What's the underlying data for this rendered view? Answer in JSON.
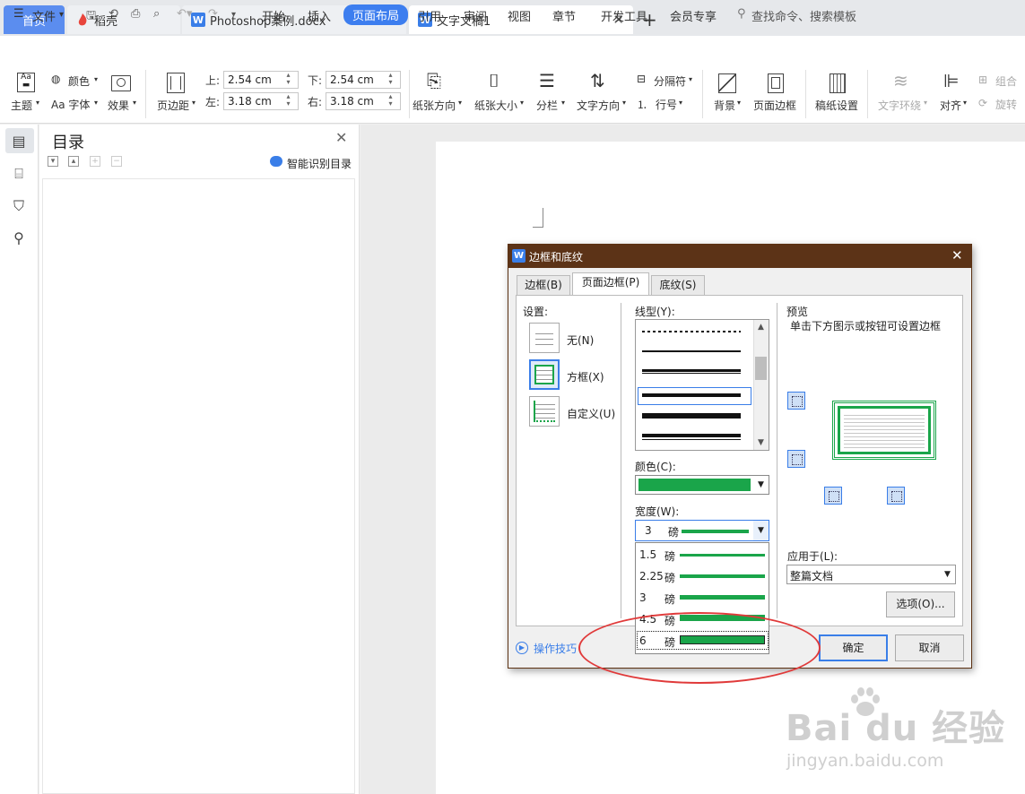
{
  "tabs": {
    "home": "首页",
    "daoke": "稻壳",
    "doc1": "Photoshop案例.docx",
    "doc2": "文字文稿1"
  },
  "menu": {
    "file": "文件",
    "items": [
      "开始",
      "插入",
      "页面布局",
      "引用",
      "审阅",
      "视图",
      "章节",
      "开发工具",
      "会员专享"
    ],
    "search": "查找命令、搜索模板"
  },
  "ribbon": {
    "theme": "主题",
    "color": "颜色",
    "font": "Aa 字体",
    "effect": "效果",
    "margins": "页边距",
    "top_label": "上:",
    "top_value": "2.54 cm",
    "bottom_label": "下:",
    "bottom_value": "2.54 cm",
    "left_label": "左:",
    "left_value": "3.18 cm",
    "right_label": "右:",
    "right_value": "3.18 cm",
    "orientation": "纸张方向",
    "size": "纸张大小",
    "columns": "分栏",
    "text_direction": "文字方向",
    "breaks": "分隔符",
    "line_numbers": "行号",
    "background": "背景",
    "page_border": "页面边框",
    "manuscript": "稿纸设置",
    "text_wrap": "文字环绕",
    "align": "对齐",
    "group": "组合",
    "rotate": "旋转"
  },
  "toc": {
    "title": "目录",
    "smart": "智能识别目录"
  },
  "dialog": {
    "title": "边框和底纹",
    "tabs": [
      "边框(B)",
      "页面边框(P)",
      "底纹(S)"
    ],
    "setting_label": "设置:",
    "settings": [
      "无(N)",
      "方框(X)",
      "自定义(U)"
    ],
    "style_label": "线型(Y):",
    "color_label": "颜色(C):",
    "width_label": "宽度(W):",
    "width_value": "3",
    "width_unit": "磅",
    "width_options": [
      {
        "value": "1.5",
        "unit": "磅"
      },
      {
        "value": "2.25",
        "unit": "磅"
      },
      {
        "value": "3",
        "unit": "磅"
      },
      {
        "value": "4.5",
        "unit": "磅"
      },
      {
        "value": "6",
        "unit": "磅"
      }
    ],
    "preview_label": "预览",
    "preview_hint": "单击下方图示或按钮可设置边框",
    "apply_label": "应用于(L):",
    "apply_value": "整篇文档",
    "options_button": "选项(O)...",
    "tips": "操作技巧",
    "ok": "确定",
    "cancel": "取消",
    "border_color": "#1aa54a"
  },
  "watermark": {
    "brand": "Bai du 经验",
    "url": "jingyan.baidu.com"
  }
}
